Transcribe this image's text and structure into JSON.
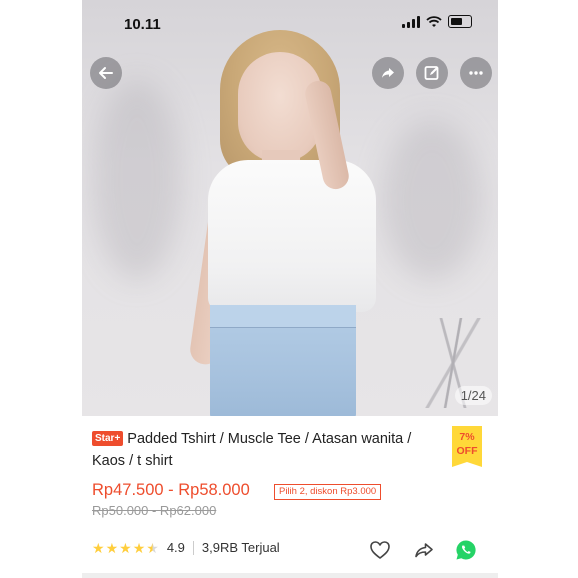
{
  "status_bar": {
    "time": "10.11"
  },
  "gallery": {
    "counter": "1/24"
  },
  "product": {
    "badge": "Star+",
    "title": "Padded Tshirt / Muscle Tee / Atasan wanita / Kaos / t shirt",
    "discount_badge": {
      "percent": "7%",
      "label": "OFF"
    },
    "price_range": "Rp47.500 - Rp58.000",
    "promo_tag": "Pilih 2, diskon Rp3.000",
    "original_price_range": "Rp50.000 - Rp62.000",
    "rating": "4.9",
    "rating_stars": 4.5,
    "sold": "3,9RB Terjual"
  },
  "colors": {
    "accent": "#ee4d2d",
    "star": "#ffce3d",
    "discount_bg": "#ffd839",
    "whatsapp": "#25d366"
  },
  "icons": {
    "back": "arrow-left-icon",
    "share": "share-icon",
    "edit": "edit-icon",
    "more": "more-icon",
    "favorite": "heart-icon",
    "whatsapp": "whatsapp-icon"
  }
}
